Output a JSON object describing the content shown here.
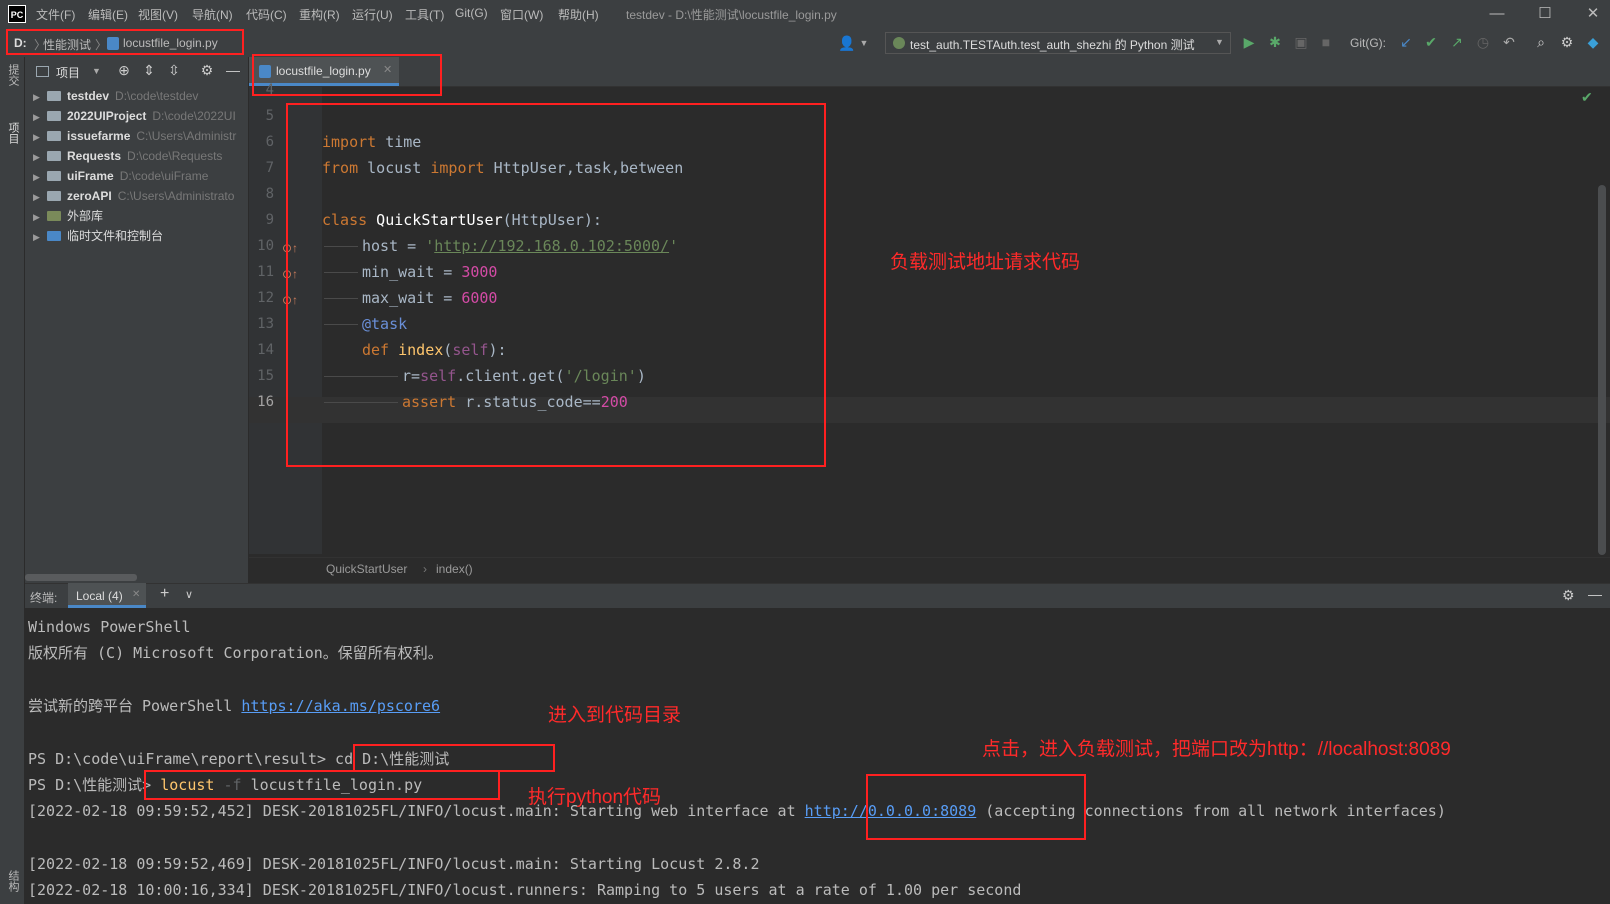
{
  "app": {
    "logo_text": "PC",
    "menu": [
      "文件(F)",
      "编辑(E)",
      "视图(V)",
      "导航(N)",
      "代码(C)",
      "重构(R)",
      "运行(U)",
      "工具(T)",
      "Git(G)",
      "窗口(W)",
      "帮助(H)"
    ],
    "window_title": "testdev - D:\\性能测试\\locustfile_login.py",
    "window_buttons": {
      "minimize": "—",
      "maximize": "☐",
      "close": "✕"
    }
  },
  "navbar": {
    "breadcrumb": [
      "D:",
      "性能测试",
      "locustfile_login.py"
    ],
    "run_config": "test_auth.TESTAuth.test_auth_shezhi 的 Python 测试",
    "git_label": "Git(G):"
  },
  "left_stripe": {
    "commit_label": "提交",
    "project_label": "项目",
    "structure_label": "结构"
  },
  "project_panel": {
    "title": "项目",
    "items": [
      {
        "name": "testdev",
        "path": "D:\\code\\testdev"
      },
      {
        "name": "2022UIProject",
        "path": "D:\\code\\2022UI"
      },
      {
        "name": "issuefarme",
        "path": "C:\\Users\\Administr"
      },
      {
        "name": "Requests",
        "path": "D:\\code\\Requests"
      },
      {
        "name": "uiFrame",
        "path": "D:\\code\\uiFrame"
      },
      {
        "name": "zeroAPI",
        "path": "C:\\Users\\Administrato"
      },
      {
        "name": "外部库",
        "path": ""
      },
      {
        "name": "临时文件和控制台",
        "path": ""
      }
    ]
  },
  "editor": {
    "tab_label": "locustfile_login.py",
    "line_numbers": [
      "4",
      "5",
      "6",
      "7",
      "8",
      "9",
      "10",
      "11",
      "12",
      "13",
      "14",
      "15",
      "16"
    ],
    "code": {
      "l6_kw": "import",
      "l6_rest": " time",
      "l7_kw1": "from",
      "l7_mod": " locust ",
      "l7_kw2": "import",
      "l7_rest": " HttpUser,task,between",
      "l9_kw": "class",
      "l9_name": " QuickStartUser",
      "l9_rest": "(HttpUser):",
      "l10_a": "host = ",
      "l10_q1": "'",
      "l10_url": "http://192.168.0.102:5000/",
      "l10_q2": "'",
      "l11_a": "min_wait = ",
      "l11_num": "3000",
      "l12_a": "max_wait = ",
      "l12_num": "6000",
      "l13_deco": "@task",
      "l14_kw": "def",
      "l14_fn": " index",
      "l14_p1": "(",
      "l14_self": "self",
      "l14_p2": "):",
      "l15_a": "r=",
      "l15_self": "self",
      "l15_b": ".client.get(",
      "l15_str": "'/login'",
      "l15_c": ")",
      "l16_kw": "assert",
      "l16_a": " r.status_code==",
      "l16_num": "200"
    },
    "breadcrumb": [
      "QuickStartUser",
      "index()"
    ]
  },
  "terminal": {
    "label": "终端:",
    "tab": "Local (4)",
    "lines": {
      "l1": "Windows PowerShell",
      "l2": "版权所有 (C) Microsoft Corporation。保留所有权利。",
      "l3_a": "尝试新的跨平台 PowerShell ",
      "l3_url": "https://aka.ms/pscore6",
      "l4_prompt": "PS D:\\code\\uiFrame\\report\\result> ",
      "l4_cmd": "cd D:\\性能测试",
      "l5_prompt": "PS D:\\性能测试> ",
      "l5_cmd": "locust",
      "l5_flag": " -f ",
      "l5_file": "locustfile_login.py",
      "l6_a": "[2022-02-18 09:59:52,452] DESK-20181025FL/INFO/locust.main: Starting web interface at ",
      "l6_url": "http://0.0.0.0:8089",
      "l6_b": " (accepting connections from all network interfaces)",
      "l7": "[2022-02-18 09:59:52,469] DESK-20181025FL/INFO/locust.main: Starting Locust 2.8.2",
      "l8": "[2022-02-18 10:00:16,334] DESK-20181025FL/INFO/locust.runners: Ramping to 5 users at a rate of 1.00 per second"
    }
  },
  "annotations": {
    "code_note": "负载测试地址请求代码",
    "cd_note": "进入到代码目录",
    "run_note": "执行python代码",
    "click_note": "点击，进入负载测试，把端口改为http：//localhost:8089"
  },
  "colors": {
    "annotation": "#ff2020",
    "keyword": "#cc7832",
    "string": "#6a8759",
    "link": "#589df6"
  }
}
